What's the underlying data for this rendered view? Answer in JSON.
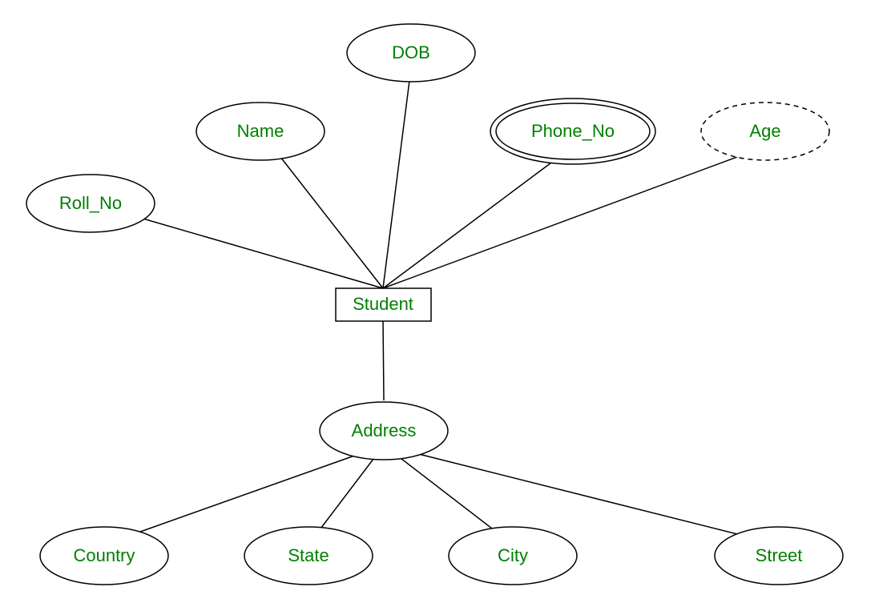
{
  "entity": {
    "label": "Student"
  },
  "attributes": {
    "roll_no": "Roll_No",
    "name": "Name",
    "dob": "DOB",
    "phone_no": "Phone_No",
    "age": "Age",
    "address": "Address"
  },
  "sub_attributes": {
    "country": "Country",
    "state": "State",
    "city": "City",
    "street": "Street"
  }
}
